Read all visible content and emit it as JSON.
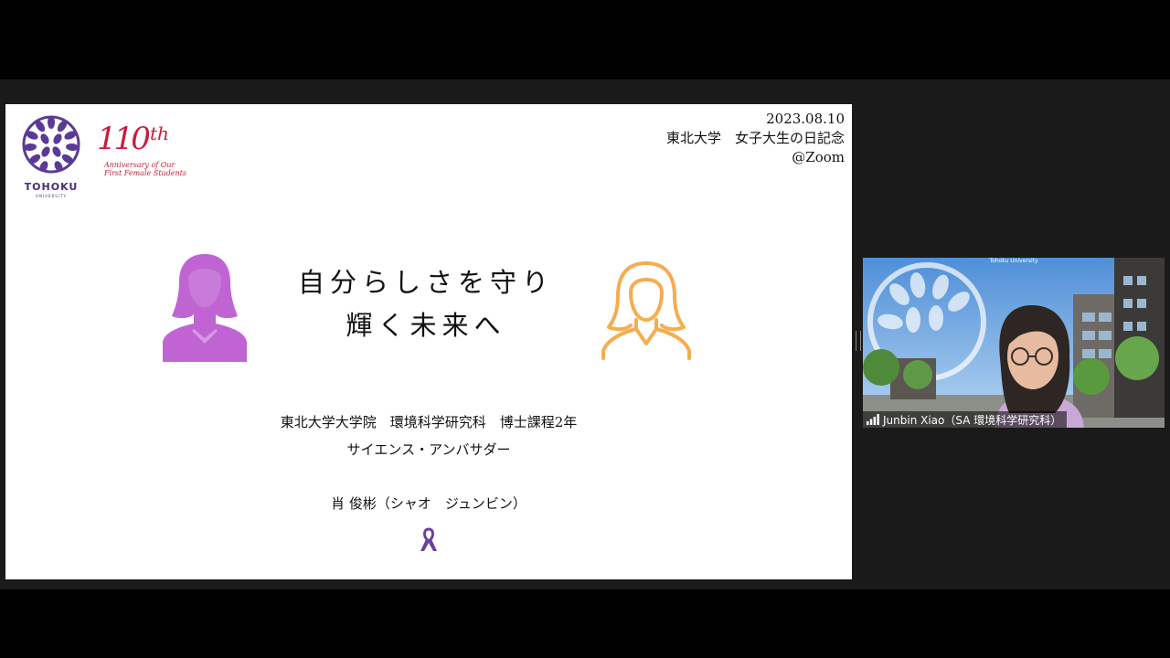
{
  "slide": {
    "date": "2023.08.10",
    "event": "東北大学　女子大生の日記念",
    "venue": "@Zoom",
    "title_line1": "自分らしさを守り",
    "title_line2": "輝く未来へ",
    "affiliation": "東北大学大学院　環境科学研究科　博士課程2年",
    "role": "サイエンス・アンバサダー",
    "speaker": "肖 俊彬（シャオ　ジュンビン）",
    "logo_tohoku_name": "TOHOKU",
    "logo_tohoku_sub": "UNIVERSITY",
    "logo_110_number": "110",
    "logo_110_suffix": "th",
    "logo_110_line1": "Anniversary of Our",
    "logo_110_line2": "First Female Students"
  },
  "video": {
    "participant_name": "Junbin Xiao（SA 環境科学研究科）",
    "background_caption": "Tohoku University",
    "signal_icon": "signal-bars-icon"
  },
  "colors": {
    "purple_icon": "#c064d4",
    "orange_icon": "#f5ad50",
    "tohoku_purple": "#4a2c7a",
    "anniversary_red": "#c81d3a"
  }
}
